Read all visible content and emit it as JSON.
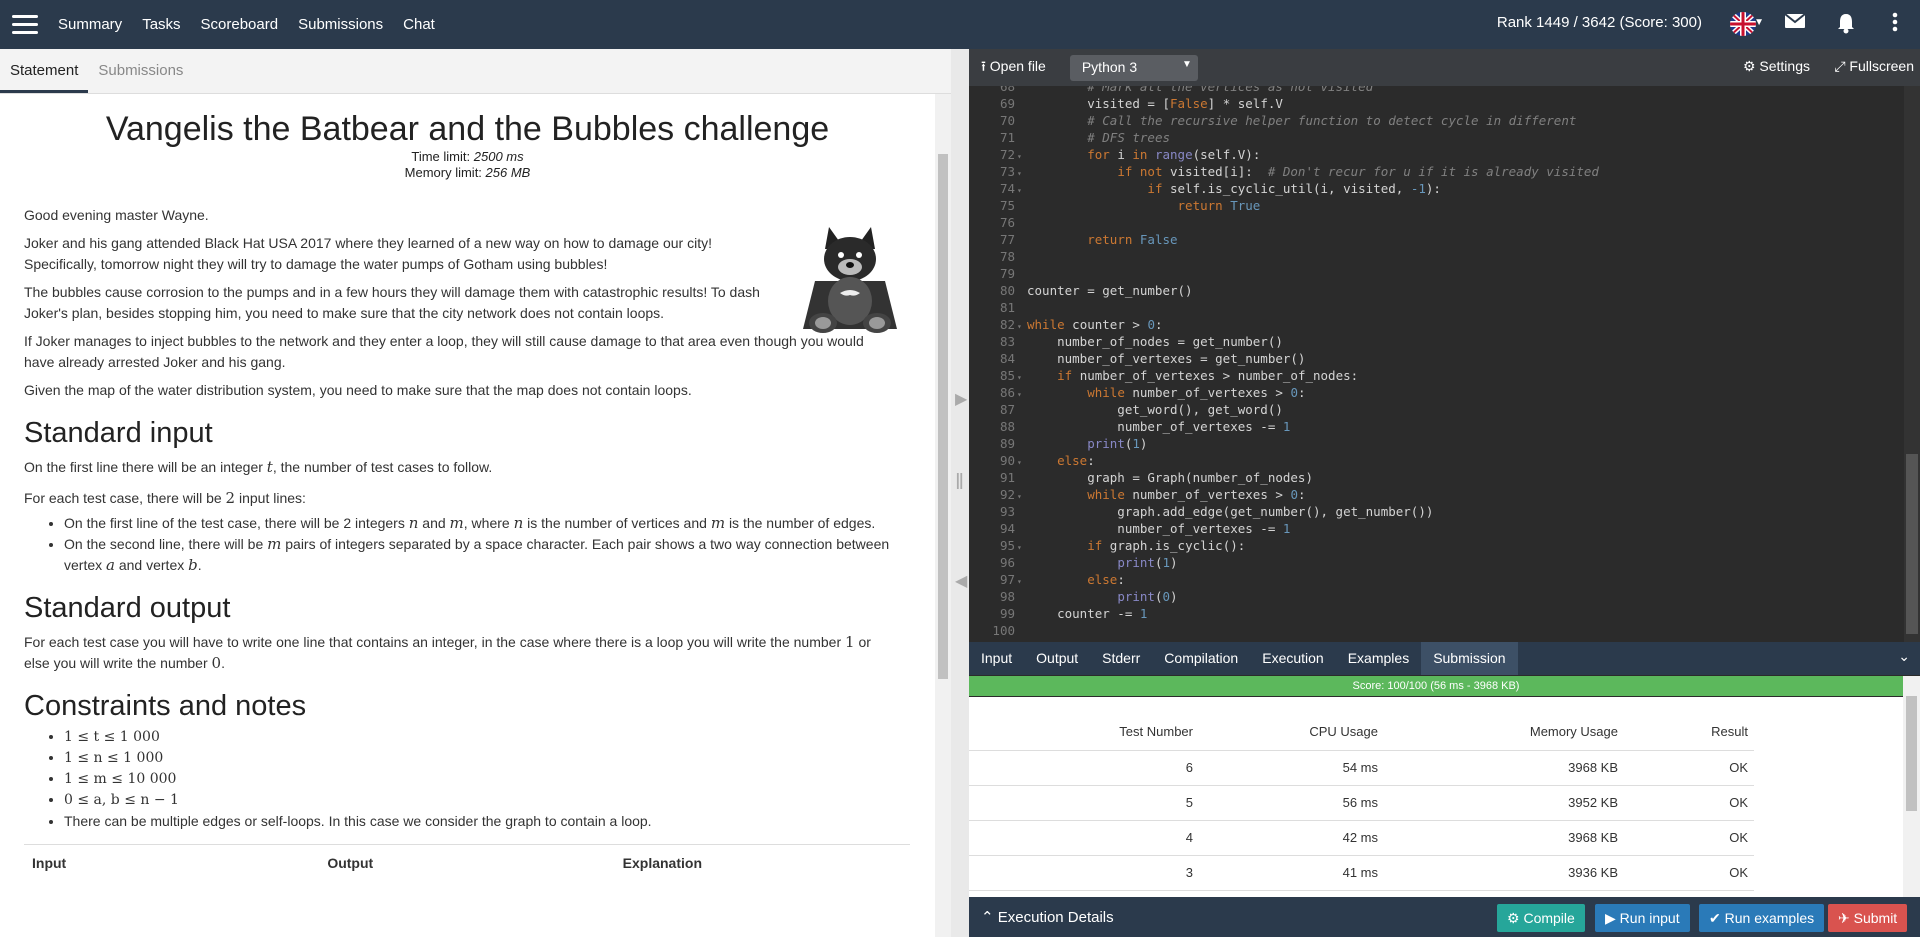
{
  "nav": {
    "items": [
      "Summary",
      "Tasks",
      "Scoreboard",
      "Submissions",
      "Chat"
    ],
    "rank": "Rank 1449 / 3642 (Score: 300)"
  },
  "left_tabs": [
    "Statement",
    "Submissions"
  ],
  "problem": {
    "title": "Vangelis the Batbear and the Bubbles challenge",
    "time_limit_label": "Time limit:",
    "time_limit": "2500 ms",
    "memory_limit_label": "Memory limit:",
    "memory_limit": "256 MB",
    "paragraphs": [
      "Good evening master Wayne.",
      "Joker and his gang attended Black Hat USA 2017 where they learned of a new way on how to damage our city! Specifically, tomorrow night they will try to damage the water pumps of Gotham using bubbles!",
      "The bubbles cause corrosion to the pumps and in a few hours they will damage them with catastrophic results! To dash Joker's plan, besides stopping him, you need to make sure that the city network does not contain loops.",
      "If Joker manages to inject bubbles to the network and they enter a loop, they will still cause damage to that area even though you would have already arrested Joker and his gang.",
      "Given the map of the water distribution system, you need to make sure that the map does not contain loops."
    ],
    "input_heading": "Standard input",
    "input_p1_a": "On the first line there will be an integer",
    "input_p1_var": "t",
    "input_p1_b": ", the number of test cases to follow.",
    "input_p2_a": "For each test case, there will be",
    "input_p2_num": "2",
    "input_p2_b": "input lines:",
    "input_b1_a": "On the first line of the test case, there will be 2 integers",
    "input_b1_n": "n",
    "input_b1_and": "and",
    "input_b1_m": "m",
    "input_b1_where": ", where",
    "input_b1_n2": "n",
    "input_b1_mid": "is the number of vertices and",
    "input_b1_m2": "m",
    "input_b1_end": "is the number of edges.",
    "input_b2_a": "On the second line, there will be",
    "input_b2_m": "m",
    "input_b2_b": "pairs of integers separated by a space character. Each pair shows a two way connection between vertex",
    "input_b2_a_var": "a",
    "input_b2_and": "and vertex",
    "input_b2_b_var": "b",
    "input_b2_end": ".",
    "output_heading": "Standard output",
    "output_p_a": "For each test case you will have to write one line that contains an integer, in the case where there is a loop you will write the number",
    "output_p_one": "1",
    "output_p_b": "or else you will write the number",
    "output_p_zero": "0",
    "output_p_end": ".",
    "constraints_heading": "Constraints and notes",
    "constraints": [
      "1 ≤ t ≤ 1 000",
      "1 ≤ n ≤ 1 000",
      "1 ≤ m ≤ 10 000",
      "0 ≤ a, b ≤ n − 1"
    ],
    "constraint_note": "There can be multiple edges or self-loops. In this case we consider the graph to contain a loop.",
    "example_cols": [
      "Input",
      "Output",
      "Explanation"
    ]
  },
  "editor": {
    "open_file": "Open file",
    "language": "Python 3",
    "settings": "Settings",
    "fullscreen": "Fullscreen"
  },
  "out_tabs": [
    "Input",
    "Output",
    "Stderr",
    "Compilation",
    "Execution",
    "Examples",
    "Submission"
  ],
  "score": "Score: 100/100 (56 ms - 3968 KB)",
  "results": {
    "headers": [
      "Test Number",
      "CPU Usage",
      "Memory Usage",
      "Result"
    ],
    "rows": [
      [
        "6",
        "54 ms",
        "3968 KB",
        "OK"
      ],
      [
        "5",
        "56 ms",
        "3952 KB",
        "OK"
      ],
      [
        "4",
        "42 ms",
        "3968 KB",
        "OK"
      ],
      [
        "3",
        "41 ms",
        "3936 KB",
        "OK"
      ]
    ]
  },
  "bottom": {
    "exec_details": "Execution Details",
    "compile": "Compile",
    "run_input": "Run input",
    "run_examples": "Run examples",
    "submit": "Submit"
  },
  "colors": {
    "topbar": "#2b3a4c",
    "score_bar": "#5cb85c",
    "compile": "#26a69a",
    "run_input": "#2a7ab8",
    "run_examples": "#2a7ab8",
    "submit": "#d9534f"
  }
}
